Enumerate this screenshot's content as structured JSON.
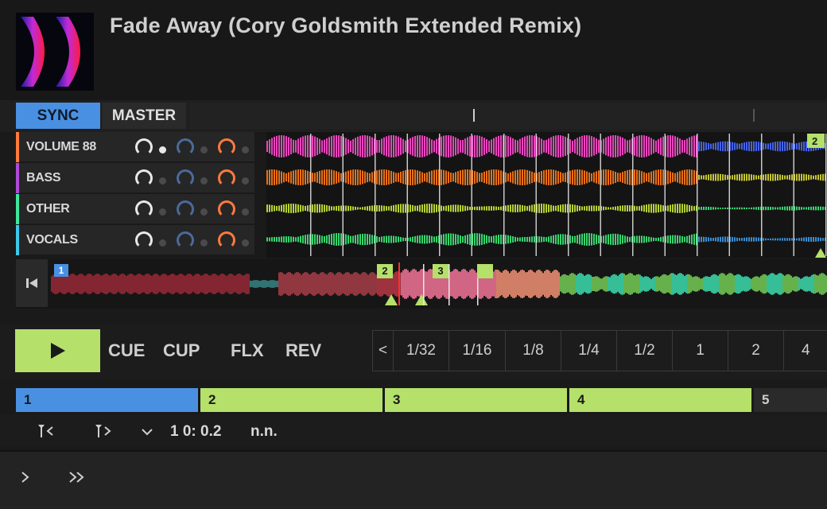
{
  "track": {
    "title": "Fade Away (Cory Goldsmith Extended Remix)"
  },
  "sync": {
    "sync_label": "SYNC",
    "master_label": "MASTER"
  },
  "stems": [
    {
      "label": "VOLUME 88",
      "color": "#ff7a3d",
      "active": true
    },
    {
      "label": "BASS",
      "color": "#b04ad8",
      "active": false
    },
    {
      "label": "OTHER",
      "color": "#3ee89a",
      "active": false
    },
    {
      "label": "VOCALS",
      "color": "#3ec8e8",
      "active": false
    }
  ],
  "overview": {
    "markers": [
      "1",
      "2",
      "3"
    ],
    "beatgrid_marker": "2"
  },
  "transport": {
    "cue_label": "CUE",
    "cup_label": "CUP",
    "flx_label": "FLX",
    "rev_label": "REV",
    "loop_prev": "<",
    "loop_sizes": [
      "1/32",
      "1/16",
      "1/8",
      "1/4",
      "1/2",
      "1",
      "2",
      "4"
    ]
  },
  "cues": [
    {
      "label": "1",
      "color": "#4a90e2"
    },
    {
      "label": "2",
      "color": "#b5e06a"
    },
    {
      "label": "3",
      "color": "#b5e06a"
    },
    {
      "label": "4",
      "color": "#b5e06a"
    },
    {
      "label": "5",
      "color": "#2a2a2a"
    }
  ],
  "info": {
    "position": "1 0: 0.2",
    "key": "n.n."
  },
  "colors": {
    "accent_blue": "#4a90e2",
    "accent_green": "#b5e06a",
    "knob_orange": "#ff7a3d"
  }
}
